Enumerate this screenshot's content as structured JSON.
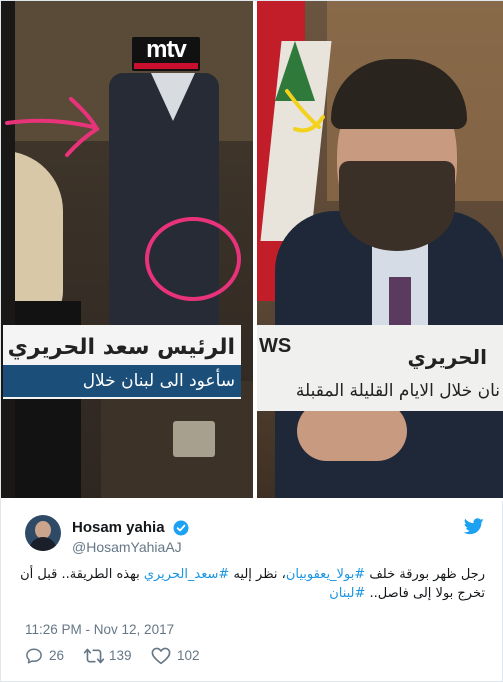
{
  "media": {
    "left_photo": {
      "channel_logo": "mtv",
      "lower_third_name": "الرئيس سعد الحريري",
      "lower_third_subtitle": "سأعود الى لبنان خلال"
    },
    "right_photo": {
      "lower_third_prefix": "WS",
      "lower_third_name": "الحريري",
      "lower_third_subtitle": "نان خلال الايام القليلة المقبلة"
    },
    "annotation_colors": {
      "pink": "#e8327a",
      "yellow": "#f2d21b"
    }
  },
  "author": {
    "display_name": "Hosam yahia",
    "handle": "@HosamYahiaAJ",
    "verified": true,
    "avatar_icon": "user-avatar"
  },
  "tweet": {
    "line1_part1": "رجل ظهر بورقة خلف ",
    "line1_hashtag1": "#بولا_يعقوبيان",
    "line1_part2": "، نظر إليه ",
    "line1_hashtag2": "#سعد_الحريري",
    "line1_part3": " بهذه الطريقة.. قبل أن",
    "line2_part1": "تخرج بولا إلى فاصل.. ",
    "line2_hashtag": "#لبنان",
    "timestamp": "11:26 PM - Nov 12, 2017"
  },
  "actions": {
    "replies": "26",
    "retweets": "139",
    "likes": "102"
  },
  "colors": {
    "link": "#1b95e0",
    "secondary_text": "#657786",
    "verified": "#1da1f2"
  }
}
